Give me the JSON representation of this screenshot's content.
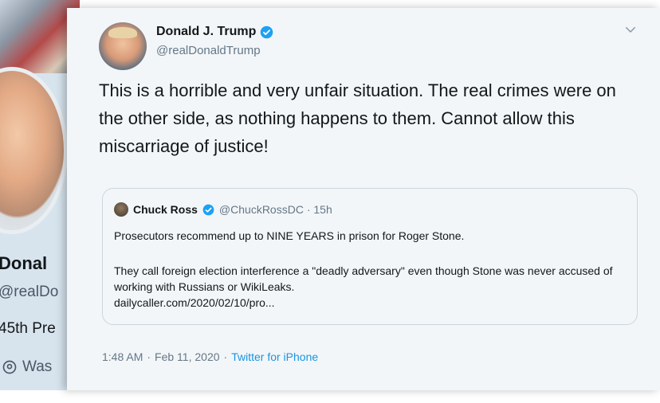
{
  "background_profile": {
    "name_partial": "Donal",
    "handle_partial": "@realDo",
    "bio_partial": "45th Pre",
    "location_partial": "Was",
    "location_icon": "location-pin-icon"
  },
  "tweet": {
    "author_name": "Donald J. Trump",
    "author_handle": "@realDonaldTrump",
    "verified_icon": "verified-badge-icon",
    "menu_icon": "chevron-down-icon",
    "text": "This is a horrible and very unfair situation. The real crimes were on the other side, as nothing happens to them. Cannot allow this miscarriage of justice!",
    "time": "1:48 AM",
    "separator": "·",
    "date": "Feb 11, 2020",
    "source": "Twitter for iPhone"
  },
  "quoted_tweet": {
    "author_name": "Chuck Ross",
    "handle_time": "@ChuckRossDC · 15h",
    "line1": "Prosecutors recommend up to NINE YEARS in prison for Roger Stone.",
    "line2": "They call foreign election interference a \"deadly adversary\" even though Stone was never accused of working with Russians or WikiLeaks.",
    "link": "dailycaller.com/2020/02/10/pro..."
  },
  "colors": {
    "accent": "#1da1f2",
    "link": "#1b95e0",
    "secondary_text": "#657786",
    "card_background": "#f2f6f9"
  }
}
